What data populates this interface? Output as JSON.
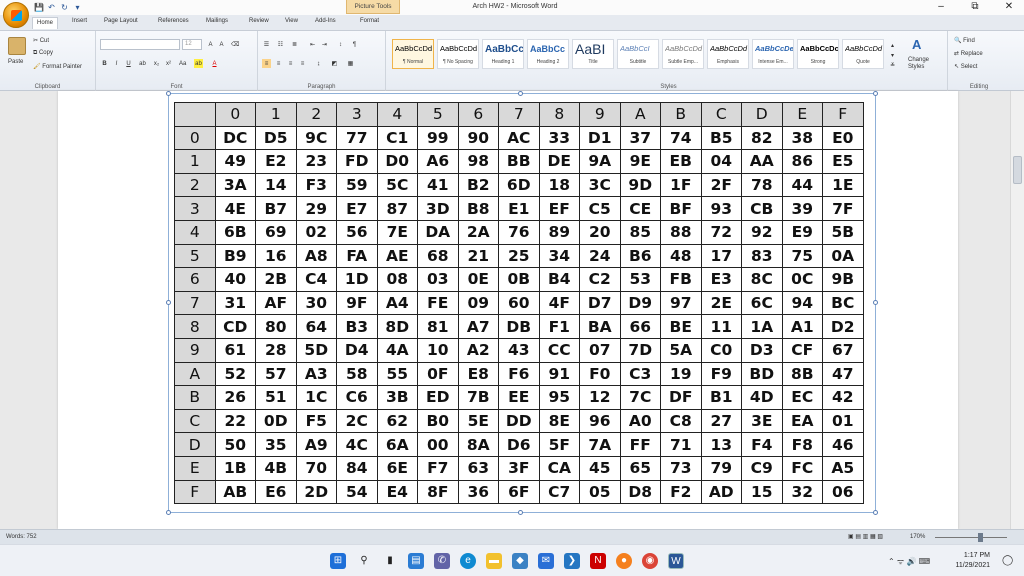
{
  "window": {
    "title": "Arch HW2 - Microsoft Word",
    "context_tab": "Picture Tools",
    "controls": {
      "minimize": "–",
      "restore": "⧉",
      "close": "✕"
    }
  },
  "quick_access": {
    "save": "💾",
    "undo": "↶",
    "redo": "↻",
    "more": "▾"
  },
  "tabs": [
    "Home",
    "Insert",
    "Page Layout",
    "References",
    "Mailings",
    "Review",
    "View",
    "Add-Ins",
    "Format"
  ],
  "ribbon": {
    "clipboard": {
      "label": "Clipboard",
      "paste": "Paste",
      "cut": "Cut",
      "copy": "Copy",
      "format_painter": "Format Painter"
    },
    "font": {
      "label": "Font",
      "font_name": "",
      "font_size": "12",
      "bold": "B",
      "italic": "I",
      "underline": "U"
    },
    "paragraph": {
      "label": "Paragraph"
    },
    "styles": {
      "label": "Styles",
      "items": [
        {
          "preview": "AaBbCcDd",
          "name": "¶ Normal"
        },
        {
          "preview": "AaBbCcDd",
          "name": "¶ No Spacing"
        },
        {
          "preview": "AaBbCc",
          "name": "Heading 1"
        },
        {
          "preview": "AaBbCc",
          "name": "Heading 2"
        },
        {
          "preview": "AaBI",
          "name": "Title"
        },
        {
          "preview": "AaBbCcI",
          "name": "Subtitle"
        },
        {
          "preview": "AaBbCcDd",
          "name": "Subtle Emp..."
        },
        {
          "preview": "AaBbCcDd",
          "name": "Emphasis"
        },
        {
          "preview": "AaBbCcDe",
          "name": "Intense Em..."
        },
        {
          "preview": "AaBbCcDc",
          "name": "Strong"
        },
        {
          "preview": "AaBbCcDd",
          "name": "Quote"
        }
      ],
      "change_styles": "Change Styles"
    },
    "editing": {
      "label": "Editing",
      "find": "Find",
      "replace": "Replace",
      "select": "Select"
    }
  },
  "hex_table": {
    "col_headers": [
      "0",
      "1",
      "2",
      "3",
      "4",
      "5",
      "6",
      "7",
      "8",
      "9",
      "A",
      "B",
      "C",
      "D",
      "E",
      "F"
    ],
    "rows": [
      {
        "label": "0",
        "cells": [
          "DC",
          "D5",
          "9C",
          "77",
          "C1",
          "99",
          "90",
          "AC",
          "33",
          "D1",
          "37",
          "74",
          "B5",
          "82",
          "38",
          "E0"
        ]
      },
      {
        "label": "1",
        "cells": [
          "49",
          "E2",
          "23",
          "FD",
          "D0",
          "A6",
          "98",
          "BB",
          "DE",
          "9A",
          "9E",
          "EB",
          "04",
          "AA",
          "86",
          "E5"
        ]
      },
      {
        "label": "2",
        "cells": [
          "3A",
          "14",
          "F3",
          "59",
          "5C",
          "41",
          "B2",
          "6D",
          "18",
          "3C",
          "9D",
          "1F",
          "2F",
          "78",
          "44",
          "1E"
        ]
      },
      {
        "label": "3",
        "cells": [
          "4E",
          "B7",
          "29",
          "E7",
          "87",
          "3D",
          "B8",
          "E1",
          "EF",
          "C5",
          "CE",
          "BF",
          "93",
          "CB",
          "39",
          "7F"
        ]
      },
      {
        "label": "4",
        "cells": [
          "6B",
          "69",
          "02",
          "56",
          "7E",
          "DA",
          "2A",
          "76",
          "89",
          "20",
          "85",
          "88",
          "72",
          "92",
          "E9",
          "5B"
        ]
      },
      {
        "label": "5",
        "cells": [
          "B9",
          "16",
          "A8",
          "FA",
          "AE",
          "68",
          "21",
          "25",
          "34",
          "24",
          "B6",
          "48",
          "17",
          "83",
          "75",
          "0A"
        ]
      },
      {
        "label": "6",
        "cells": [
          "40",
          "2B",
          "C4",
          "1D",
          "08",
          "03",
          "0E",
          "0B",
          "B4",
          "C2",
          "53",
          "FB",
          "E3",
          "8C",
          "0C",
          "9B"
        ]
      },
      {
        "label": "7",
        "cells": [
          "31",
          "AF",
          "30",
          "9F",
          "A4",
          "FE",
          "09",
          "60",
          "4F",
          "D7",
          "D9",
          "97",
          "2E",
          "6C",
          "94",
          "BC"
        ]
      },
      {
        "label": "8",
        "cells": [
          "CD",
          "80",
          "64",
          "B3",
          "8D",
          "81",
          "A7",
          "DB",
          "F1",
          "BA",
          "66",
          "BE",
          "11",
          "1A",
          "A1",
          "D2"
        ]
      },
      {
        "label": "9",
        "cells": [
          "61",
          "28",
          "5D",
          "D4",
          "4A",
          "10",
          "A2",
          "43",
          "CC",
          "07",
          "7D",
          "5A",
          "C0",
          "D3",
          "CF",
          "67"
        ]
      },
      {
        "label": "A",
        "cells": [
          "52",
          "57",
          "A3",
          "58",
          "55",
          "0F",
          "E8",
          "F6",
          "91",
          "F0",
          "C3",
          "19",
          "F9",
          "BD",
          "8B",
          "47"
        ]
      },
      {
        "label": "B",
        "cells": [
          "26",
          "51",
          "1C",
          "C6",
          "3B",
          "ED",
          "7B",
          "EE",
          "95",
          "12",
          "7C",
          "DF",
          "B1",
          "4D",
          "EC",
          "42"
        ]
      },
      {
        "label": "C",
        "cells": [
          "22",
          "0D",
          "F5",
          "2C",
          "62",
          "B0",
          "5E",
          "DD",
          "8E",
          "96",
          "A0",
          "C8",
          "27",
          "3E",
          "EA",
          "01"
        ]
      },
      {
        "label": "D",
        "cells": [
          "50",
          "35",
          "A9",
          "4C",
          "6A",
          "00",
          "8A",
          "D6",
          "5F",
          "7A",
          "FF",
          "71",
          "13",
          "F4",
          "F8",
          "46"
        ]
      },
      {
        "label": "E",
        "cells": [
          "1B",
          "4B",
          "70",
          "84",
          "6E",
          "F7",
          "63",
          "3F",
          "CA",
          "45",
          "65",
          "73",
          "79",
          "C9",
          "FC",
          "A5"
        ]
      },
      {
        "label": "F",
        "cells": [
          "AB",
          "E6",
          "2D",
          "54",
          "E4",
          "8F",
          "36",
          "6F",
          "C7",
          "05",
          "D8",
          "F2",
          "AD",
          "15",
          "32",
          "06"
        ]
      }
    ]
  },
  "status": {
    "words": "Words: 752",
    "zoom": "170%"
  },
  "taskbar": {
    "time": "1:17 PM",
    "date": "11/29/2021"
  }
}
